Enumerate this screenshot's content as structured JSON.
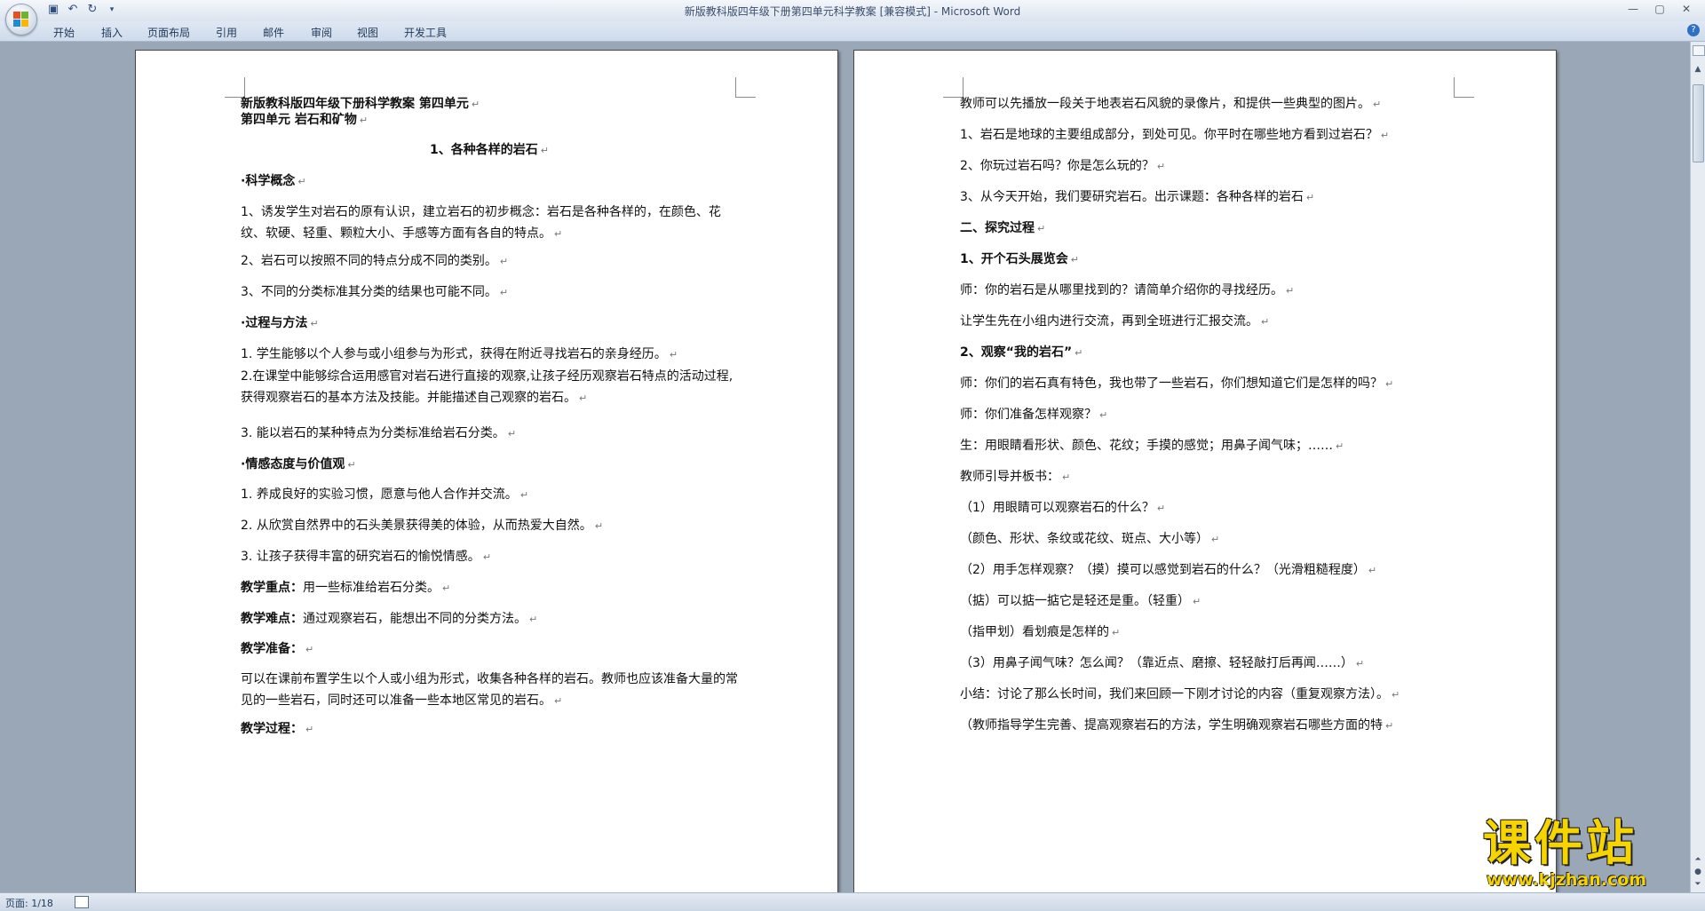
{
  "window": {
    "title": "新版教科版四年级下册第四单元科学教案 [兼容模式] - Microsoft Word",
    "controls": [
      "—",
      "▢",
      "✕"
    ]
  },
  "ribbon": {
    "tabs": [
      "开始",
      "插入",
      "页面布局",
      "引用",
      "邮件",
      "审阅",
      "视图",
      "开发工具"
    ],
    "help": "?"
  },
  "page1": {
    "lines": [
      {
        "text": "新版教科版四年级下册科学教案  第四单元",
        "bold": true
      },
      {
        "text": "第四单元 岩石和矿物",
        "bold": true
      },
      {
        "text": "1、各种各样的岩石",
        "bold": true,
        "center": true
      },
      {
        "text": "·科学概念",
        "bold": true
      },
      {
        "text": "1、诱发学生对岩石的原有认识，建立岩石的初步概念：岩石是各种各样的，在颜色、花纹、软硬、轻重、颗粒大小、手感等方面有各自的特点。"
      },
      {
        "text": "2、岩石可以按照不同的特点分成不同的类别。"
      },
      {
        "text": "3、不同的分类标准其分类的结果也可能不同。"
      },
      {
        "text": "·过程与方法",
        "bold": true
      },
      {
        "text": "1. 学生能够以个人参与或小组参与为形式，获得在附近寻找岩石的亲身经历。"
      },
      {
        "text": "2.在课堂中能够综合运用感官对岩石进行直接的观察,让孩子经历观察岩石特点的活动过程,获得观察岩石的基本方法及技能。并能描述自己观察的岩石。"
      },
      {
        "text": "3. 能以岩石的某种特点为分类标准给岩石分类。"
      },
      {
        "text": "·情感态度与价值观",
        "bold": true
      },
      {
        "text": "1. 养成良好的实验习惯，愿意与他人合作并交流。"
      },
      {
        "text": "2. 从欣赏自然界中的石头美景获得美的体验，从而热爱大自然。"
      },
      {
        "text": "3. 让孩子获得丰富的研究岩石的愉悦情感。"
      },
      {
        "label": "教学重点：",
        "text": "用一些标准给岩石分类。"
      },
      {
        "label": "教学难点：",
        "text": "通过观察岩石，能想出不同的分类方法。"
      },
      {
        "label": "教学准备：",
        "text": ""
      },
      {
        "text": "可以在课前布置学生以个人或小组为形式，收集各种各样的岩石。教师也应该准备大量的常见的一些岩石，同时还可以准备一些本地区常见的岩石。"
      },
      {
        "label": "教学过程：",
        "text": ""
      }
    ]
  },
  "page2": {
    "lines": [
      {
        "text": "教师可以先播放一段关于地表岩石风貌的录像片，和提供一些典型的图片。"
      },
      {
        "text": "1、岩石是地球的主要组成部分，到处可见。你平时在哪些地方看到过岩石？"
      },
      {
        "text": "2、你玩过岩石吗？你是怎么玩的？"
      },
      {
        "text": "3、从今天开始，我们要研究岩石。出示课题：各种各样的岩石"
      },
      {
        "text": "二、探究过程",
        "bold": true
      },
      {
        "text": "1、开个石头展览会",
        "bold": true
      },
      {
        "text": "师：你的岩石是从哪里找到的？请简单介绍你的寻找经历。"
      },
      {
        "text": "让学生先在小组内进行交流，再到全班进行汇报交流。"
      },
      {
        "text": "2、观察“我的岩石”",
        "bold": true
      },
      {
        "text": "师：你们的岩石真有特色，我也带了一些岩石，你们想知道它们是怎样的吗？"
      },
      {
        "text": "师：你们准备怎样观察？"
      },
      {
        "text": "生：用眼睛看形状、颜色、花纹；手摸的感觉；用鼻子闻气味；……"
      },
      {
        "text": "教师引导并板书："
      },
      {
        "text": "（1）用眼睛可以观察岩石的什么？"
      },
      {
        "text": "（颜色、形状、条纹或花纹、斑点、大小等）"
      },
      {
        "text": "（2）用手怎样观察？（摸）摸可以感觉到岩石的什么？（光滑粗糙程度）"
      },
      {
        "text": "（掂）可以掂一掂它是轻还是重。（轻重）"
      },
      {
        "text": "（指甲划）看划痕是怎样的"
      },
      {
        "text": "（3）用鼻子闻气味？怎么闻？（靠近点、磨擦、轻轻敲打后再闻……）"
      },
      {
        "text": "小结：讨论了那么长时间，我们来回顾一下刚才讨论的内容（重复观察方法）。"
      },
      {
        "text": "（教师指导学生完善、提高观察岩石的方法，学生明确观察岩石哪些方面的特"
      }
    ]
  },
  "statusbar": {
    "page_info": "页面: 1/18"
  },
  "watermark": {
    "big": "课件站",
    "small": "www.kjzhan.com"
  },
  "paragraph_mark": "↵"
}
